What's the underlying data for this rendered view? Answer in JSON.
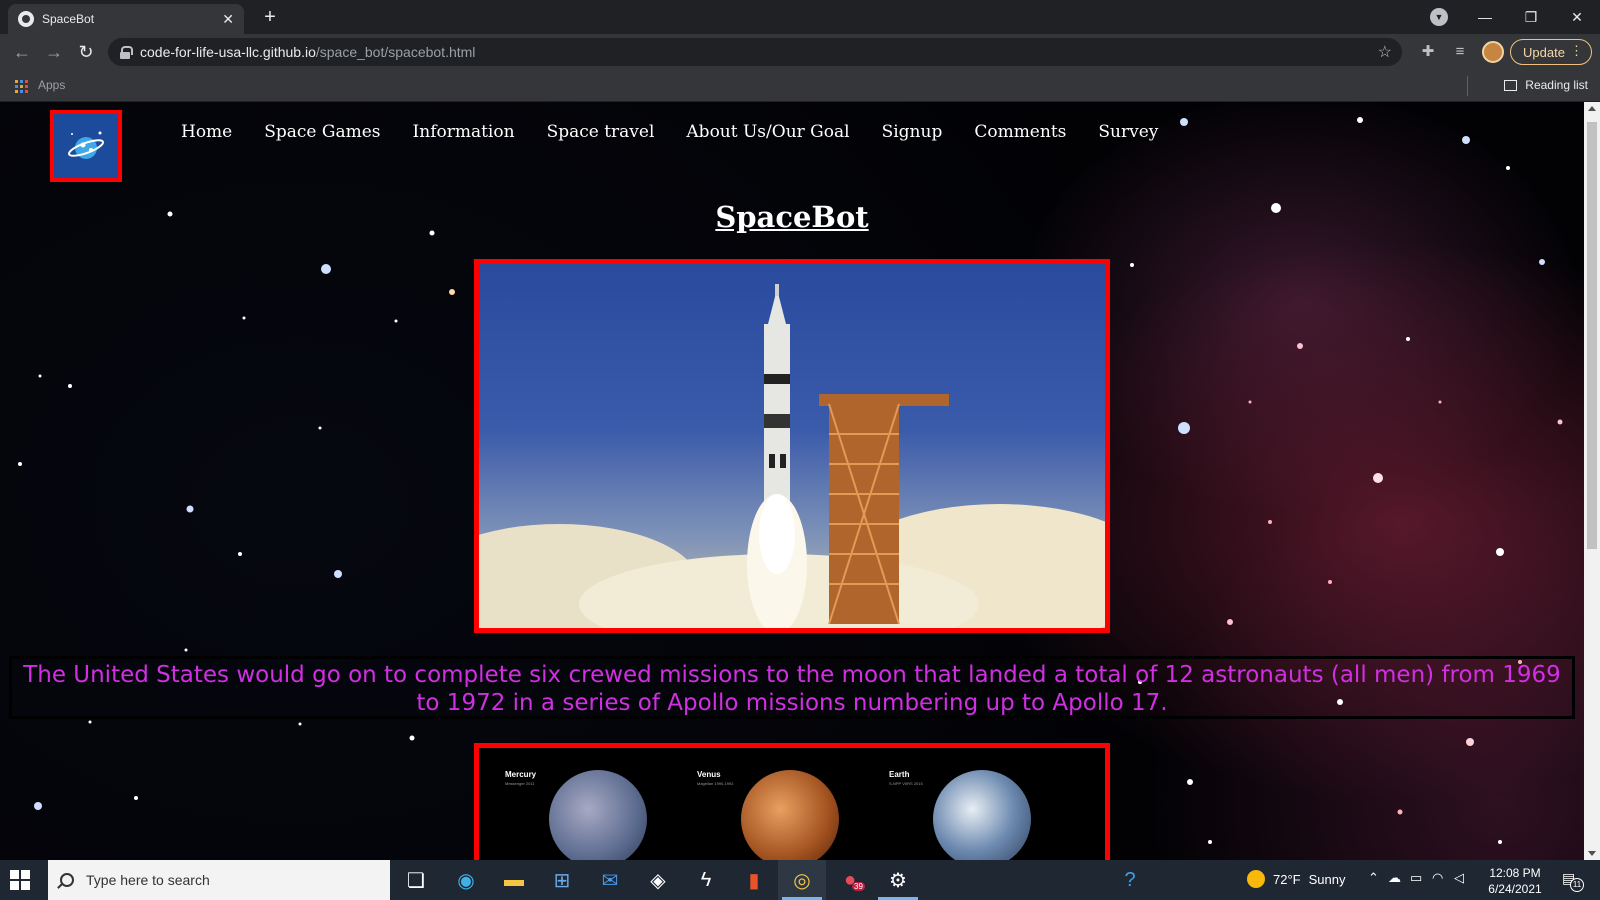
{
  "browser": {
    "tab_title": "SpaceBot",
    "tab_close": "✕",
    "new_tab": "+",
    "url_host": "code-for-life-usa-llc.github.io",
    "url_path": "/space_bot/spacebot.html",
    "update_label": "Update",
    "bookmarks": {
      "apps_label": "Apps",
      "reading_list_label": "Reading list"
    }
  },
  "site": {
    "nav": [
      {
        "label": "Home"
      },
      {
        "label": "Space Games"
      },
      {
        "label": "Information"
      },
      {
        "label": "Space travel"
      },
      {
        "label": "About Us/Our Goal"
      },
      {
        "label": "Signup"
      },
      {
        "label": "Comments"
      },
      {
        "label": "Survey"
      }
    ],
    "title": "SpaceBot",
    "caption": "The United States would go on to complete six crewed missions to the moon that landed a total of 12 astronauts (all men) from 1969 to 1972 in a series of Apollo missions numbering up to Apollo 17.",
    "planets": [
      {
        "name": "Mercury",
        "meta": "Messenger 2011",
        "color": "#7c8aa8"
      },
      {
        "name": "Venus",
        "meta": "Magellan 1990-1992",
        "color": "#b0622a"
      },
      {
        "name": "Earth",
        "meta": "S-NPP VIIRS 2015",
        "color": "#4a6a9a"
      }
    ],
    "accent_color": "#ff0000",
    "caption_color": "#d12fe2"
  },
  "taskbar": {
    "search_placeholder": "Type here to search",
    "weather_temp": "72°F",
    "weather_text": "Sunny",
    "time": "12:08 PM",
    "date": "6/24/2021",
    "notification_count": "11",
    "badge_count": "39"
  }
}
